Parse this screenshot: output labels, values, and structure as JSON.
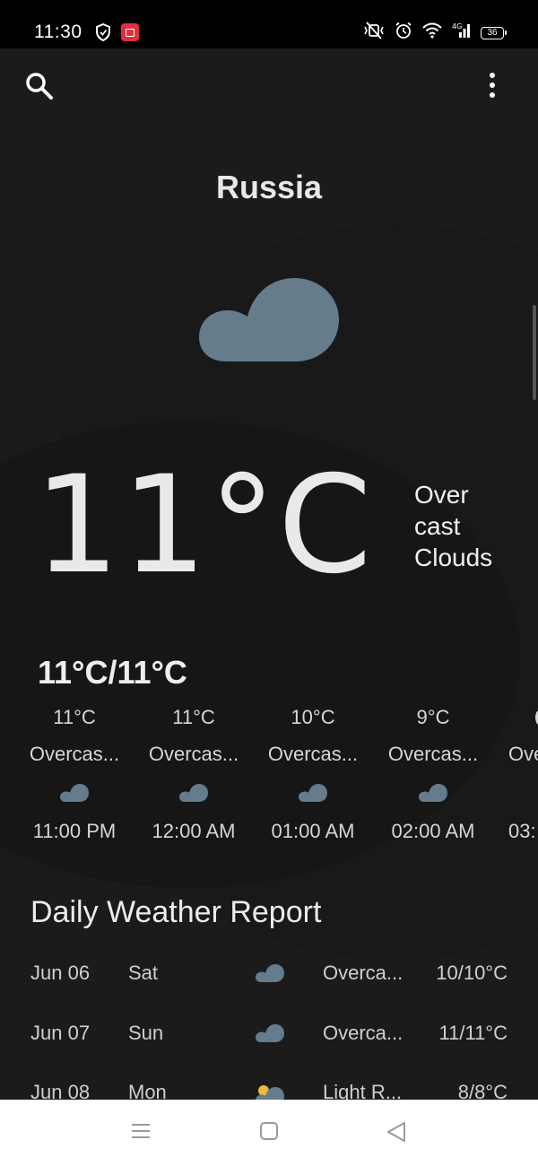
{
  "status_bar": {
    "time": "11:30",
    "network": "4G",
    "battery": "36"
  },
  "toolbar": {
    "search_icon": "search-icon",
    "more_icon": "more-vert-icon"
  },
  "location": {
    "name": "Russia"
  },
  "current": {
    "icon": "cloud-icon",
    "temperature": "11°C",
    "description": "Over cast Clouds",
    "description_lines": [
      "Over",
      "cast",
      "Clouds"
    ],
    "min_max": "11°C/11°C"
  },
  "hourly": [
    {
      "temp": "11°C",
      "desc": "Overcas...",
      "time": "11:00 PM",
      "icon": "cloud-icon"
    },
    {
      "temp": "11°C",
      "desc": "Overcas...",
      "time": "12:00 AM",
      "icon": "cloud-icon"
    },
    {
      "temp": "10°C",
      "desc": "Overcas...",
      "time": "01:00 AM",
      "icon": "cloud-icon"
    },
    {
      "temp": "9°C",
      "desc": "Overcas...",
      "time": "02:00 AM",
      "icon": "cloud-icon"
    },
    {
      "temp": "",
      "desc": "Ove",
      "time": "03:",
      "icon": ""
    }
  ],
  "daily": {
    "title": "Daily Weather Report",
    "rows": [
      {
        "date": "Jun 06",
        "day": "Sat",
        "icon": "cloud-icon",
        "desc": "Overca...",
        "temp": "10/10°C"
      },
      {
        "date": "Jun 07",
        "day": "Sun",
        "icon": "cloud-icon",
        "desc": "Overca...",
        "temp": "11/11°C"
      },
      {
        "date": "Jun 08",
        "day": "Mon",
        "icon": "sun-cloud-icon",
        "desc": "Light R...",
        "temp": "8/8°C"
      }
    ]
  },
  "colors": {
    "background": "#1b1b1c",
    "cloud": "#647c8c",
    "text": "#e6e6e6",
    "status_bar": "#000000",
    "nav_bar": "#ffffff"
  },
  "nav_bar": {
    "icons": [
      "menu-icon",
      "home-icon",
      "back-icon"
    ]
  }
}
